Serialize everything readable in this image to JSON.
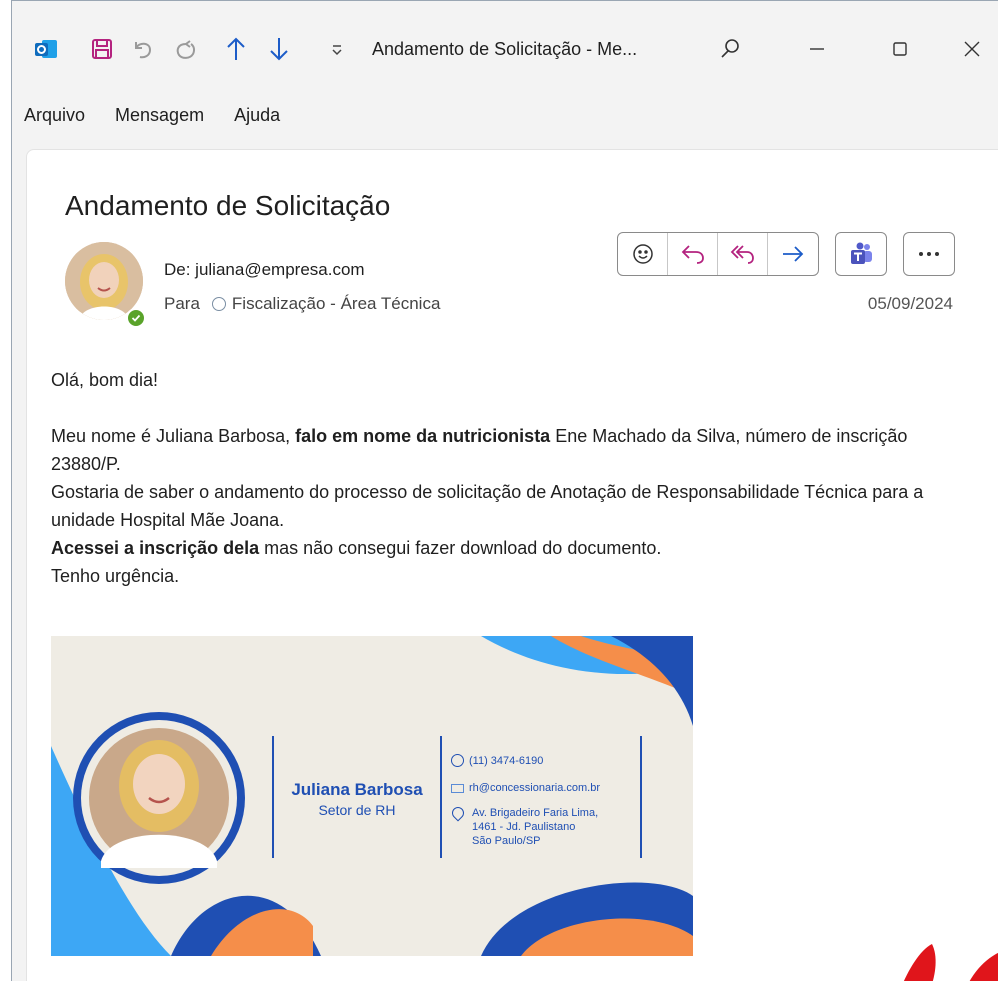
{
  "titlebar": {
    "title": "Andamento de Solicitação  -  Me...",
    "save_icon": "save-icon",
    "undo_icon": "undo-icon",
    "redo_icon": "redo-icon",
    "up_icon": "arrow-up-icon",
    "down_icon": "arrow-down-icon",
    "customize_icon": "customize-toolbar-icon",
    "search_icon": "search-icon",
    "minimize_icon": "minimize-icon",
    "maximize_icon": "maximize-icon",
    "close_icon": "close-icon"
  },
  "menubar": {
    "items": [
      "Arquivo",
      "Mensagem",
      "Ajuda"
    ]
  },
  "message": {
    "subject": "Andamento de Solicitação",
    "from": "De: juliana@empresa.com",
    "to_label": "Para",
    "to_value": "Fiscalização - Área Técnica",
    "date": "05/09/2024",
    "actions": [
      "emoji-icon",
      "reply-icon",
      "reply-all-icon",
      "forward-icon",
      "teams-icon",
      "more-icon"
    ],
    "body": {
      "greeting": "Olá, bom dia!",
      "p1_a": "Meu nome é Juliana Barbosa, ",
      "p1_bold": "falo em nome da nutricionista",
      "p1_b": " Ene Machado da Silva, número de inscrição 23880/P.",
      "p2": "Gostaria de saber o andamento do processo de solicitação de Anotação de Responsabilidade Técnica para a unidade Hospital Mãe Joana.",
      "p3_bold": "Acessei a inscrição dela",
      "p3_b": " mas não consegui fazer download do documento.",
      "p4": "Tenho urgência."
    }
  },
  "signature": {
    "name": "Juliana Barbosa",
    "department": "Setor de RH",
    "phone": "(11) 3474-6190",
    "email": "rh@concessionaria.com.br",
    "address_line1": "Av. Brigadeiro Faria Lima,",
    "address_line2": "1461 - Jd. Paulistano",
    "address_line3": "São Paulo/SP"
  },
  "colors": {
    "accent": "#1c5cc8",
    "sig_blue": "#1f4fb3",
    "sig_lightblue": "#3da7f5",
    "sig_orange": "#f58e4a",
    "presence": "#5aa32a",
    "teams": "#5059c9"
  }
}
